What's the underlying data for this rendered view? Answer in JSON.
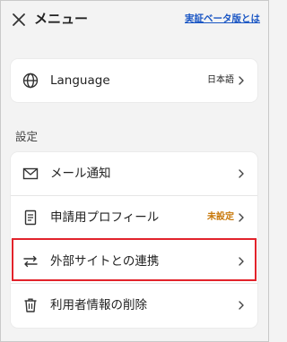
{
  "header": {
    "title": "メニュー",
    "beta_link": "実証ベータ版とは"
  },
  "language": {
    "label": "Language",
    "value": "日本語"
  },
  "settings": {
    "section_label": "設定",
    "items": [
      {
        "label": "メール通知",
        "value": ""
      },
      {
        "label": "申請用プロフィール",
        "value": "未設定"
      },
      {
        "label": "外部サイトとの連携",
        "value": ""
      },
      {
        "label": "利用者情報の削除",
        "value": ""
      }
    ]
  },
  "colors": {
    "background": "#f3f3f3",
    "card": "#ffffff",
    "link": "#1a56c4",
    "unset_badge": "#c8780a",
    "highlight": "#e2232b"
  },
  "icons": {
    "close": "close-icon",
    "language": "globe-icon",
    "mail": "mail-icon",
    "profile": "document-icon",
    "external": "swap-arrows-icon",
    "delete": "trash-icon",
    "chevron": "chevron-right-icon"
  }
}
